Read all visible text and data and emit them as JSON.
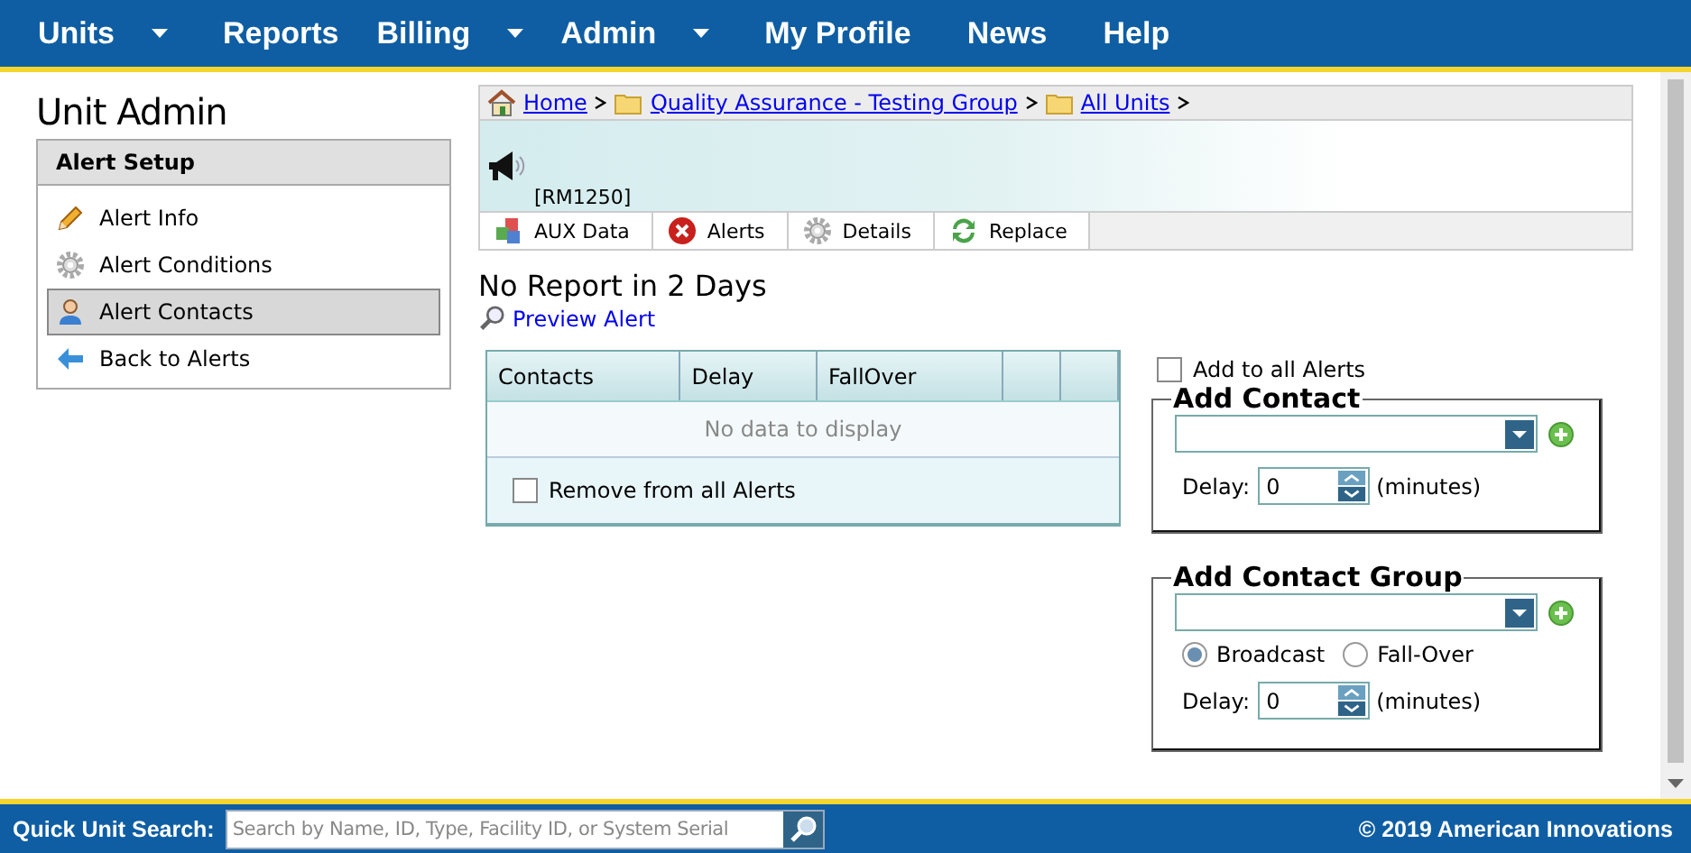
{
  "nav": [
    {
      "label": "Units",
      "dropdown": true
    },
    {
      "label": "Reports",
      "dropdown": false
    },
    {
      "label": "Billing",
      "dropdown": true
    },
    {
      "label": "Admin",
      "dropdown": true
    },
    {
      "label": "My Profile",
      "dropdown": false
    },
    {
      "label": "News",
      "dropdown": false
    },
    {
      "label": "Help",
      "dropdown": false
    }
  ],
  "sidebar": {
    "title": "Unit Admin",
    "header": "Alert Setup",
    "items": [
      {
        "label": "Alert Info",
        "kind": "pencil",
        "selected": false
      },
      {
        "label": "Alert Conditions",
        "kind": "gear",
        "selected": false
      },
      {
        "label": "Alert Contacts",
        "kind": "person",
        "selected": true
      },
      {
        "label": "Back to Alerts",
        "kind": "back",
        "selected": false
      }
    ]
  },
  "breadcrumb": [
    {
      "label": "Home",
      "kind": "home"
    },
    {
      "label": "Quality Assurance - Testing Group",
      "kind": "folder"
    },
    {
      "label": "All Units",
      "kind": "folder"
    }
  ],
  "unit": {
    "id": "[RM1250]"
  },
  "toolbar": [
    {
      "label": "AUX Data",
      "kind": "cubes"
    },
    {
      "label": "Alerts",
      "kind": "error"
    },
    {
      "label": "Details",
      "kind": "gear"
    },
    {
      "label": "Replace",
      "kind": "replace"
    }
  ],
  "alert_title": "No Report in 2 Days",
  "preview_link": "Preview Alert",
  "grid": {
    "columns": [
      "Contacts",
      "Delay",
      "FallOver"
    ],
    "empty_text": "No data to display",
    "remove_all": {
      "label": "Remove from all Alerts",
      "checked": false
    }
  },
  "add_to_all": {
    "label": "Add to all Alerts",
    "checked": false
  },
  "add_contact": {
    "title": "Add Contact",
    "delay_label": "Delay:",
    "delay_value": "0",
    "unit": "(minutes)"
  },
  "add_contact_group": {
    "title": "Add Contact Group",
    "modes": [
      {
        "label": "Broadcast",
        "selected": true
      },
      {
        "label": "Fall-Over",
        "selected": false
      }
    ],
    "delay_label": "Delay:",
    "delay_value": "0",
    "unit": "(minutes)"
  },
  "footer": {
    "search_label": "Quick Unit Search:",
    "search_placeholder": "Search by Name, ID, Type, Facility ID, or System Serial",
    "copyright": "© 2019 American Innovations"
  }
}
